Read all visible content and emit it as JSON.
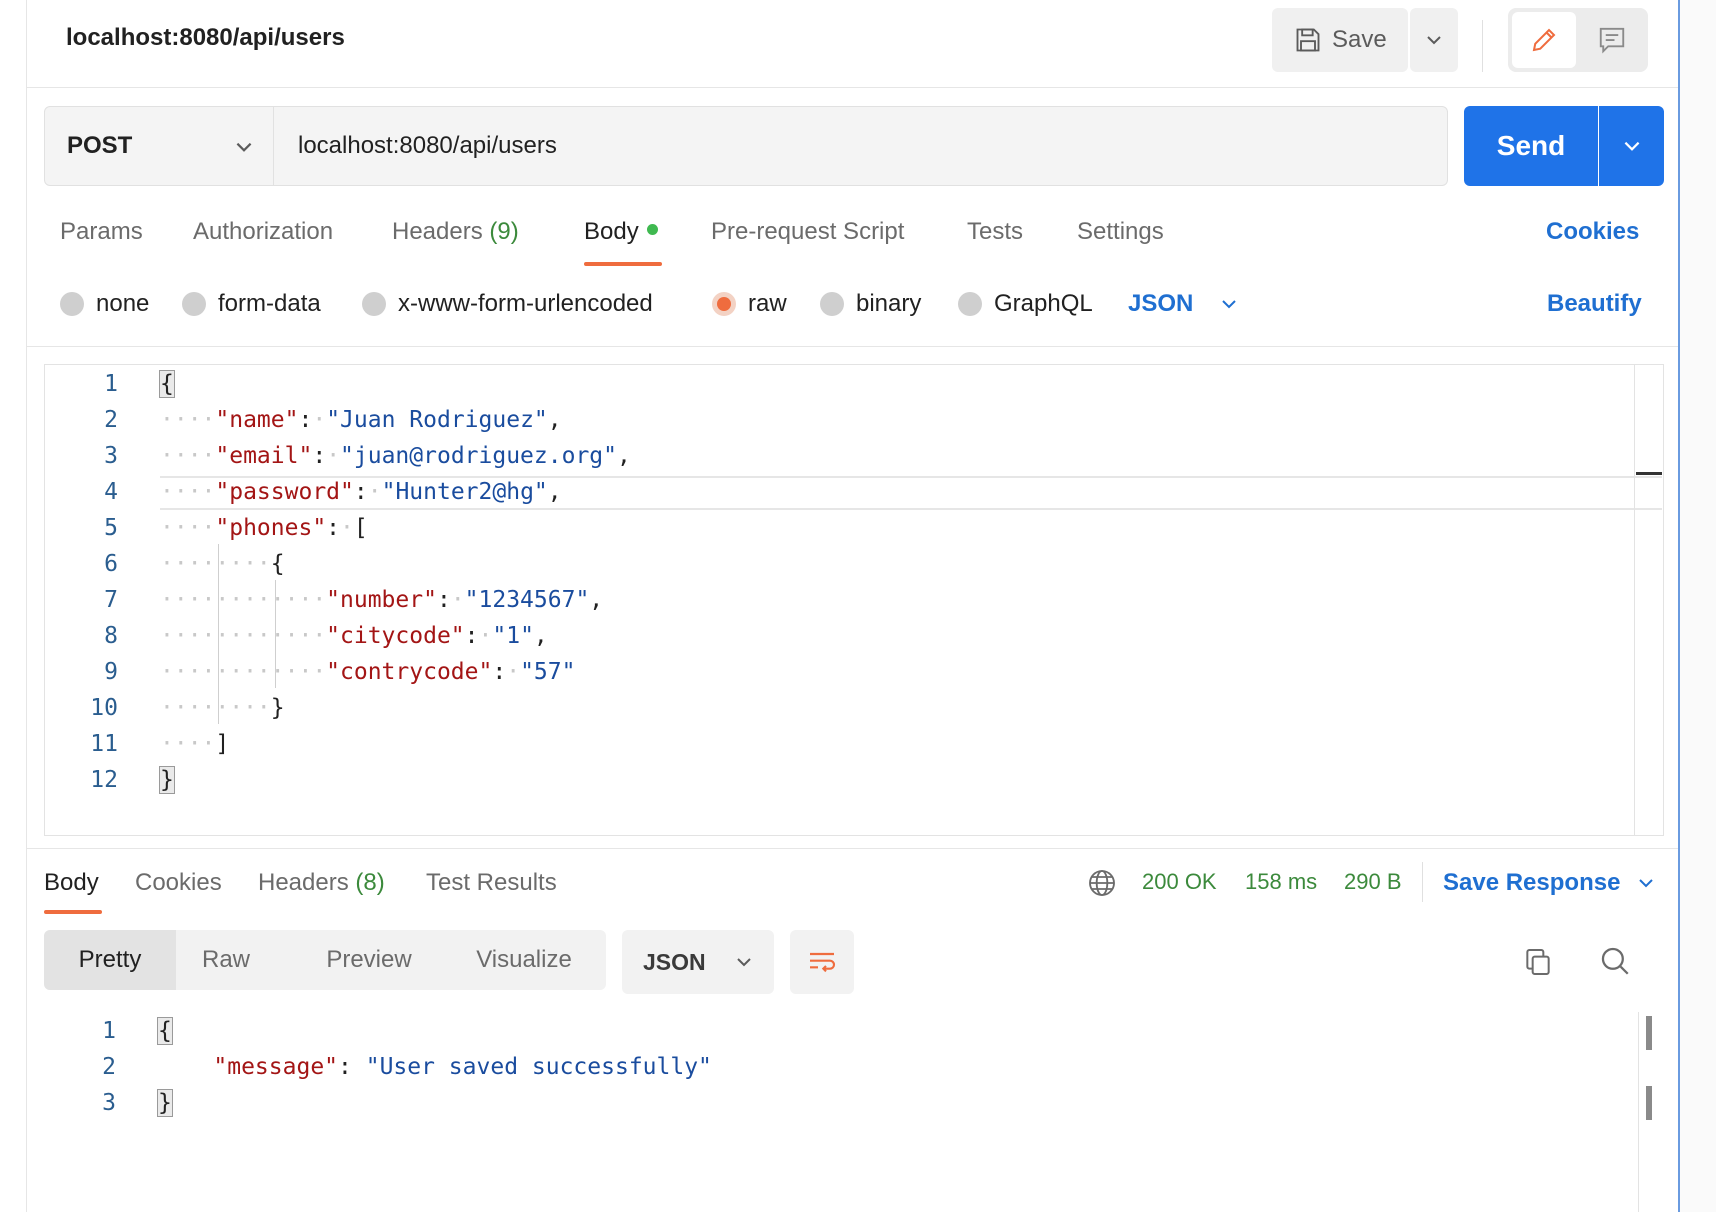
{
  "header": {
    "title": "localhost:8080/api/users",
    "save_label": "Save"
  },
  "request": {
    "method": "POST",
    "url": "localhost:8080/api/users",
    "send_label": "Send",
    "tabs": {
      "params": "Params",
      "authorization": "Authorization",
      "headers": "Headers",
      "headers_count": "(9)",
      "body": "Body",
      "prerequest": "Pre-request Script",
      "tests": "Tests",
      "settings": "Settings"
    },
    "cookies_label": "Cookies",
    "body_types": {
      "none": "none",
      "form_data": "form-data",
      "urlencoded": "x-www-form-urlencoded",
      "raw": "raw",
      "binary": "binary",
      "graphql": "GraphQL"
    },
    "selected_body_type": "raw",
    "language": "JSON",
    "beautify_label": "Beautify",
    "line_numbers": [
      "1",
      "2",
      "3",
      "4",
      "5",
      "6",
      "7",
      "8",
      "9",
      "10",
      "11",
      "12"
    ],
    "body_json": {
      "name_key": "\"name\"",
      "name_val": "\"Juan Rodriguez\"",
      "email_key": "\"email\"",
      "email_val": "\"juan@rodriguez.org\"",
      "password_key": "\"password\"",
      "password_val": "\"Hunter2@hg\"",
      "phones_key": "\"phones\"",
      "number_key": "\"number\"",
      "number_val": "\"1234567\"",
      "citycode_key": "\"citycode\"",
      "citycode_val": "\"1\"",
      "contrycode_key": "\"contrycode\"",
      "contrycode_val": "\"57\""
    }
  },
  "response": {
    "tabs": {
      "body": "Body",
      "cookies": "Cookies",
      "headers": "Headers",
      "headers_count": "(8)",
      "test_results": "Test Results"
    },
    "status": "200 OK",
    "time": "158 ms",
    "size": "290 B",
    "save_response_label": "Save Response",
    "views": {
      "pretty": "Pretty",
      "raw": "Raw",
      "preview": "Preview",
      "visualize": "Visualize"
    },
    "format": "JSON",
    "line_numbers": [
      "1",
      "2",
      "3"
    ],
    "body_json": {
      "message_key": "\"message\"",
      "message_val": "\"User saved successfully\""
    }
  },
  "colors": {
    "accent_blue": "#1f73e8",
    "tab_underline": "#ef6c3e",
    "status_green": "#3c8a3c",
    "json_key": "#a31515",
    "json_string": "#1a4c9e"
  },
  "icons": {
    "save": "floppy-disk-icon",
    "edit": "pencil-icon",
    "comment": "comment-icon",
    "network": "globe-icon",
    "wrap": "text-wrap-icon",
    "copy": "copy-icon",
    "search": "search-icon"
  }
}
